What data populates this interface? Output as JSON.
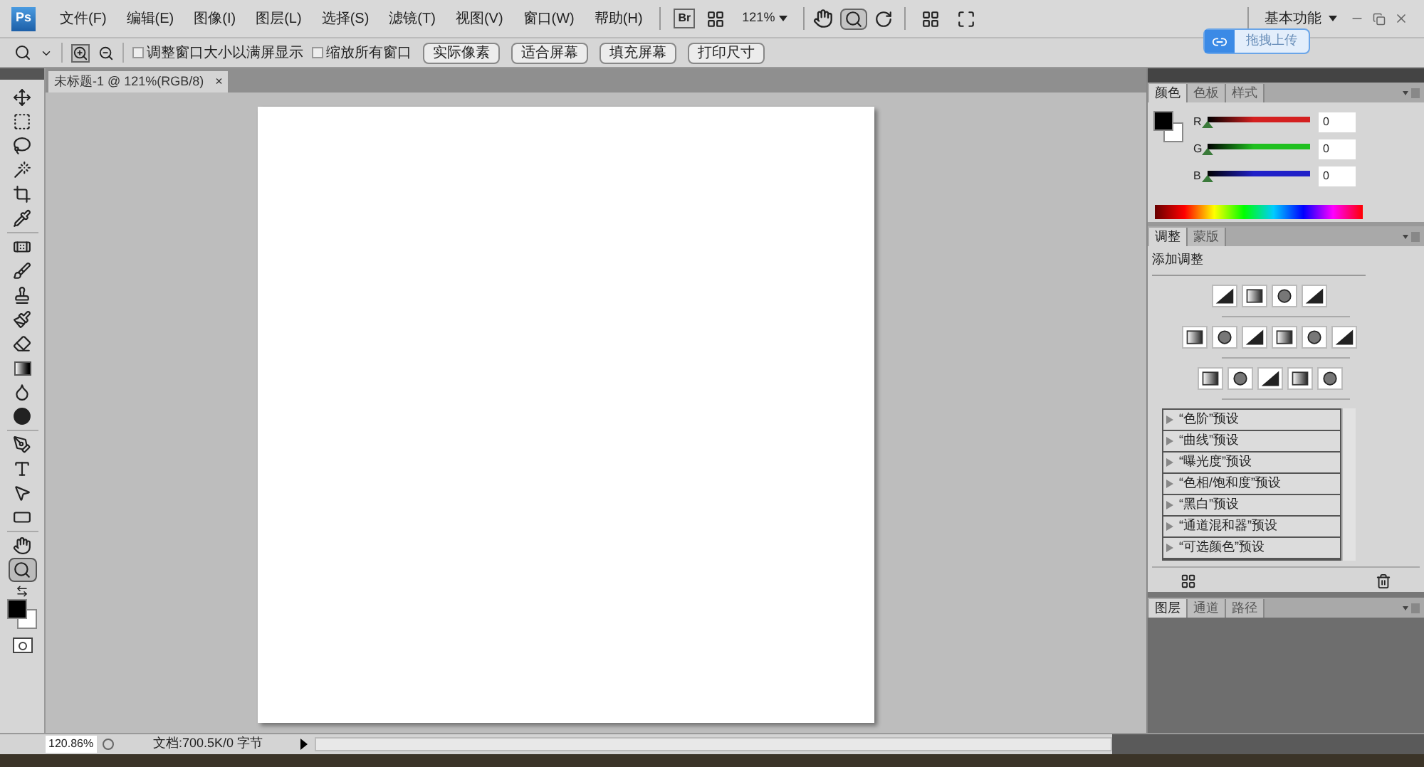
{
  "app_logo": "Ps",
  "menu": [
    "文件(F)",
    "编辑(E)",
    "图像(I)",
    "图层(L)",
    "选择(S)",
    "滤镜(T)",
    "视图(V)",
    "窗口(W)",
    "帮助(H)"
  ],
  "menu_tools": {
    "bridge": "Br",
    "zoom_level": "121%",
    "workspace": "基本功能"
  },
  "upload_widget": {
    "label": "拖拽上传"
  },
  "options": {
    "checkboxes": [
      {
        "label": "调整窗口大小以满屏显示",
        "checked": false
      },
      {
        "label": "缩放所有窗口",
        "checked": false
      }
    ],
    "buttons": [
      "实际像素",
      "适合屏幕",
      "填充屏幕",
      "打印尺寸"
    ]
  },
  "document_tab": {
    "title": "未标题-1 @ 121%(RGB/8)",
    "close": "×"
  },
  "tools": [
    {
      "kind": "move",
      "selected": false
    },
    {
      "kind": "marquee",
      "selected": false
    },
    {
      "kind": "lasso",
      "selected": false
    },
    {
      "kind": "wand",
      "selected": false
    },
    {
      "kind": "crop",
      "selected": false
    },
    {
      "kind": "eyedropper",
      "selected": false
    },
    {
      "kind": "healing",
      "selected": false
    },
    {
      "kind": "brush",
      "selected": false
    },
    {
      "kind": "stamp",
      "selected": false
    },
    {
      "kind": "history",
      "selected": false
    },
    {
      "kind": "eraser",
      "selected": false
    },
    {
      "kind": "gradient",
      "selected": false
    },
    {
      "kind": "blur",
      "selected": false
    },
    {
      "kind": "dodge",
      "selected": false
    },
    {
      "kind": "pen",
      "selected": false
    },
    {
      "kind": "type",
      "selected": false
    },
    {
      "kind": "select",
      "selected": false
    },
    {
      "kind": "shape",
      "selected": false
    },
    {
      "kind": "hand",
      "selected": false
    },
    {
      "kind": "zoom",
      "selected": true
    }
  ],
  "color_panel": {
    "tabs": [
      {
        "label": "颜色",
        "selected": true
      },
      {
        "label": "色板",
        "selected": false
      },
      {
        "label": "样式",
        "selected": false
      }
    ],
    "channels": [
      {
        "label": "R",
        "value": "0",
        "level": 0,
        "color": "#d42020"
      },
      {
        "label": "G",
        "value": "0",
        "level": 0,
        "color": "#20c020"
      },
      {
        "label": "B",
        "value": "0",
        "level": 0,
        "color": "#2020c8"
      }
    ]
  },
  "adjustments_panel": {
    "tabs": [
      {
        "label": "调整",
        "selected": true
      },
      {
        "label": "蒙版",
        "selected": false
      }
    ],
    "heading": "添加调整",
    "presets": [
      "“色阶”预设",
      "“曲线”预设",
      "“曝光度”预设",
      "“色相/饱和度”预设",
      "“黑白”预设",
      "“通道混和器”预设",
      "“可选颜色”预设"
    ]
  },
  "layers_panel": {
    "tabs": [
      {
        "label": "图层",
        "selected": true
      },
      {
        "label": "通道",
        "selected": false
      },
      {
        "label": "路径",
        "selected": false
      }
    ]
  },
  "status_bar": {
    "zoom": "120.86%",
    "document": "文档:700.5K/0 字节"
  }
}
